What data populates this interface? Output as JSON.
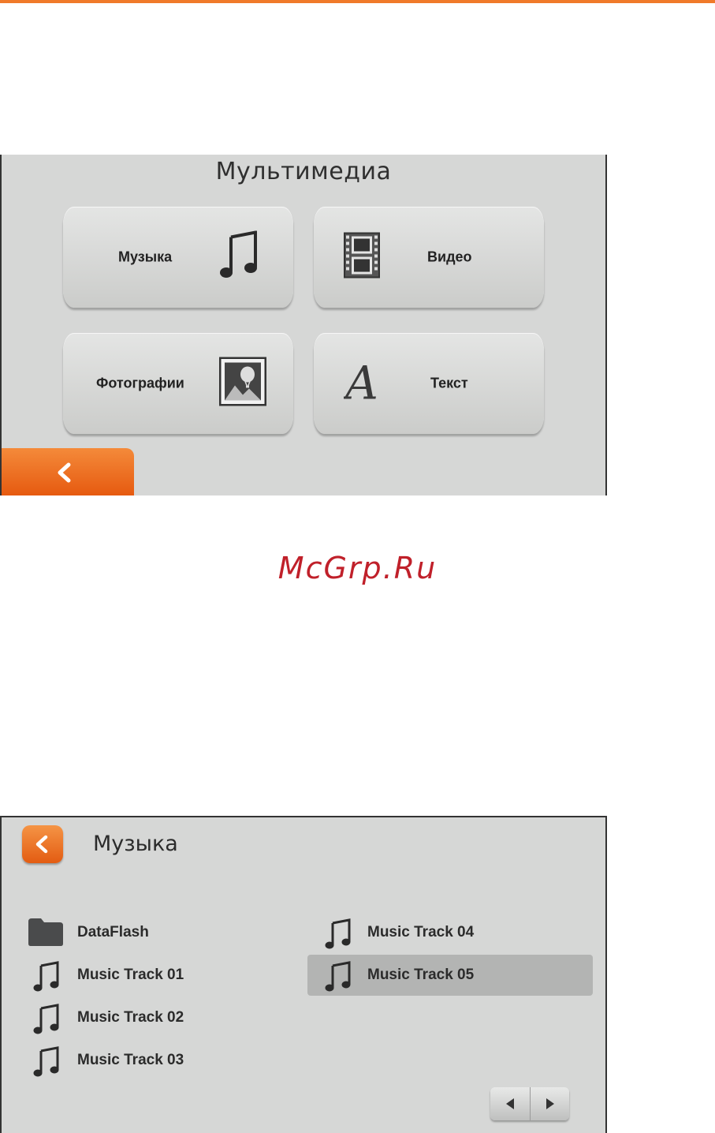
{
  "screen1": {
    "title": "Мультимедиа",
    "tiles": [
      {
        "label": "Музыка",
        "icon": "music-note-icon"
      },
      {
        "label": "Видео",
        "icon": "film-strip-icon"
      },
      {
        "label": "Фотографии",
        "icon": "photo-icon"
      },
      {
        "label": "Текст",
        "icon": "letter-a-icon"
      }
    ],
    "back_icon": "chevron-left-icon",
    "accent_color": "#f07a2a"
  },
  "watermark": "McGrp.Ru",
  "screen2": {
    "title": "Музыка",
    "back_icon": "chevron-left-icon",
    "items": [
      {
        "label": "DataFlash",
        "icon": "folder-icon",
        "selected": false
      },
      {
        "label": "Music Track 01",
        "icon": "music-note-icon",
        "selected": false
      },
      {
        "label": "Music Track 02",
        "icon": "music-note-icon",
        "selected": false
      },
      {
        "label": "Music Track 03",
        "icon": "music-note-icon",
        "selected": false
      },
      {
        "label": "Music Track 04",
        "icon": "music-note-icon",
        "selected": false
      },
      {
        "label": "Music Track 05",
        "icon": "music-note-icon",
        "selected": true
      }
    ],
    "pager": {
      "prev_icon": "triangle-left-icon",
      "next_icon": "triangle-right-icon"
    }
  }
}
